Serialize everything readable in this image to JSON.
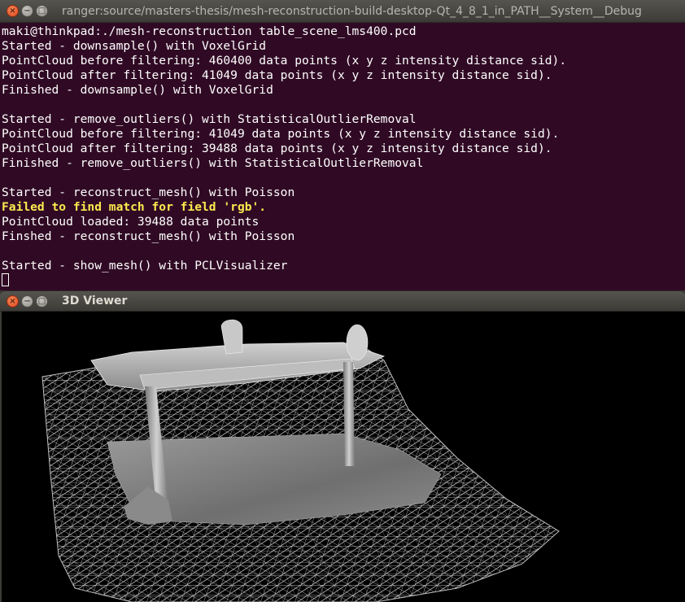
{
  "terminal_window": {
    "title": "ranger:source/masters-thesis/mesh-reconstruction-build-desktop-Qt_4_8_1_in_PATH__System__Debug",
    "buttons": {
      "close": "×",
      "minimize": "−",
      "maximize": "□"
    },
    "lines": [
      {
        "text": "maki@thinkpad:./mesh-reconstruction table_scene_lms400.pcd",
        "style": "normal"
      },
      {
        "text": "Started - downsample() with VoxelGrid",
        "style": "normal"
      },
      {
        "text": "PointCloud before filtering: 460400 data points (x y z intensity distance sid).",
        "style": "normal"
      },
      {
        "text": "PointCloud after filtering: 41049 data points (x y z intensity distance sid).",
        "style": "normal"
      },
      {
        "text": "Finished - downsample() with VoxelGrid",
        "style": "normal"
      },
      {
        "text": "",
        "style": "normal"
      },
      {
        "text": "Started - remove_outliers() with StatisticalOutlierRemoval",
        "style": "normal"
      },
      {
        "text": "PointCloud before filtering: 41049 data points (x y z intensity distance sid).",
        "style": "normal"
      },
      {
        "text": "PointCloud after filtering: 39488 data points (x y z intensity distance sid).",
        "style": "normal"
      },
      {
        "text": "Finished - remove_outliers() with StatisticalOutlierRemoval",
        "style": "normal"
      },
      {
        "text": "",
        "style": "normal"
      },
      {
        "text": "Started - reconstruct_mesh() with Poisson",
        "style": "normal"
      },
      {
        "text": "Failed to find match for field 'rgb'.",
        "style": "warn"
      },
      {
        "text": "PointCloud loaded: 39488 data points",
        "style": "normal"
      },
      {
        "text": "Finshed - reconstruct_mesh() with Poisson",
        "style": "normal"
      },
      {
        "text": "",
        "style": "normal"
      },
      {
        "text": "Started - show_mesh() with PCLVisualizer",
        "style": "normal"
      }
    ]
  },
  "viewer_window": {
    "title": "3D Viewer",
    "buttons": {
      "close": "×",
      "minimize": "−",
      "maximize": "□"
    }
  },
  "colors": {
    "terminal_background": "#300a24",
    "terminal_text": "#ffffff",
    "warning_text": "#fce94f",
    "viewer_background": "#000000",
    "titlebar": "#3c3b37"
  }
}
